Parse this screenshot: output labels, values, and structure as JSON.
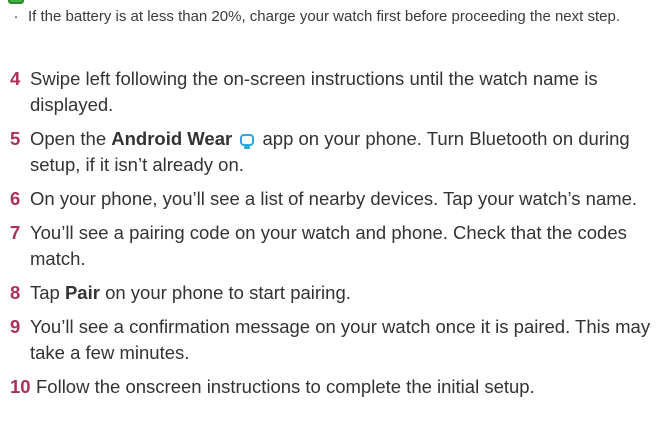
{
  "note": {
    "bullet": "·",
    "text": "If the battery is at less than 20%, charge your watch first before proceeding the next step."
  },
  "steps": [
    {
      "number": "4",
      "text": "Swipe left following the on-screen instructions until the watch name is displayed."
    },
    {
      "number": "5",
      "before": "Open the ",
      "bold": "Android Wear",
      "after": " app on your phone. Turn Bluetooth on during setup, if it isn’t already on.",
      "icon": "android-wear-app-icon"
    },
    {
      "number": "6",
      "text": "On your phone, you’ll see a list of nearby devices. Tap your watch’s name."
    },
    {
      "number": "7",
      "text": "You’ll see a pairing code on your watch and phone. Check that the codes match."
    },
    {
      "number": "8",
      "before": "Tap ",
      "bold": "Pair",
      "after": " on your phone to start pairing."
    },
    {
      "number": "9",
      "text": "You’ll see a confirmation message on your watch once it is paired. This may take a few minutes."
    },
    {
      "number": "10",
      "text": "Follow the onscreen instructions to complete the initial setup."
    }
  ],
  "colors": {
    "step_number": "#a8325a",
    "body_text": "#333333",
    "note_icon": "#3cb043",
    "wear_icon": "#27a9e1"
  }
}
